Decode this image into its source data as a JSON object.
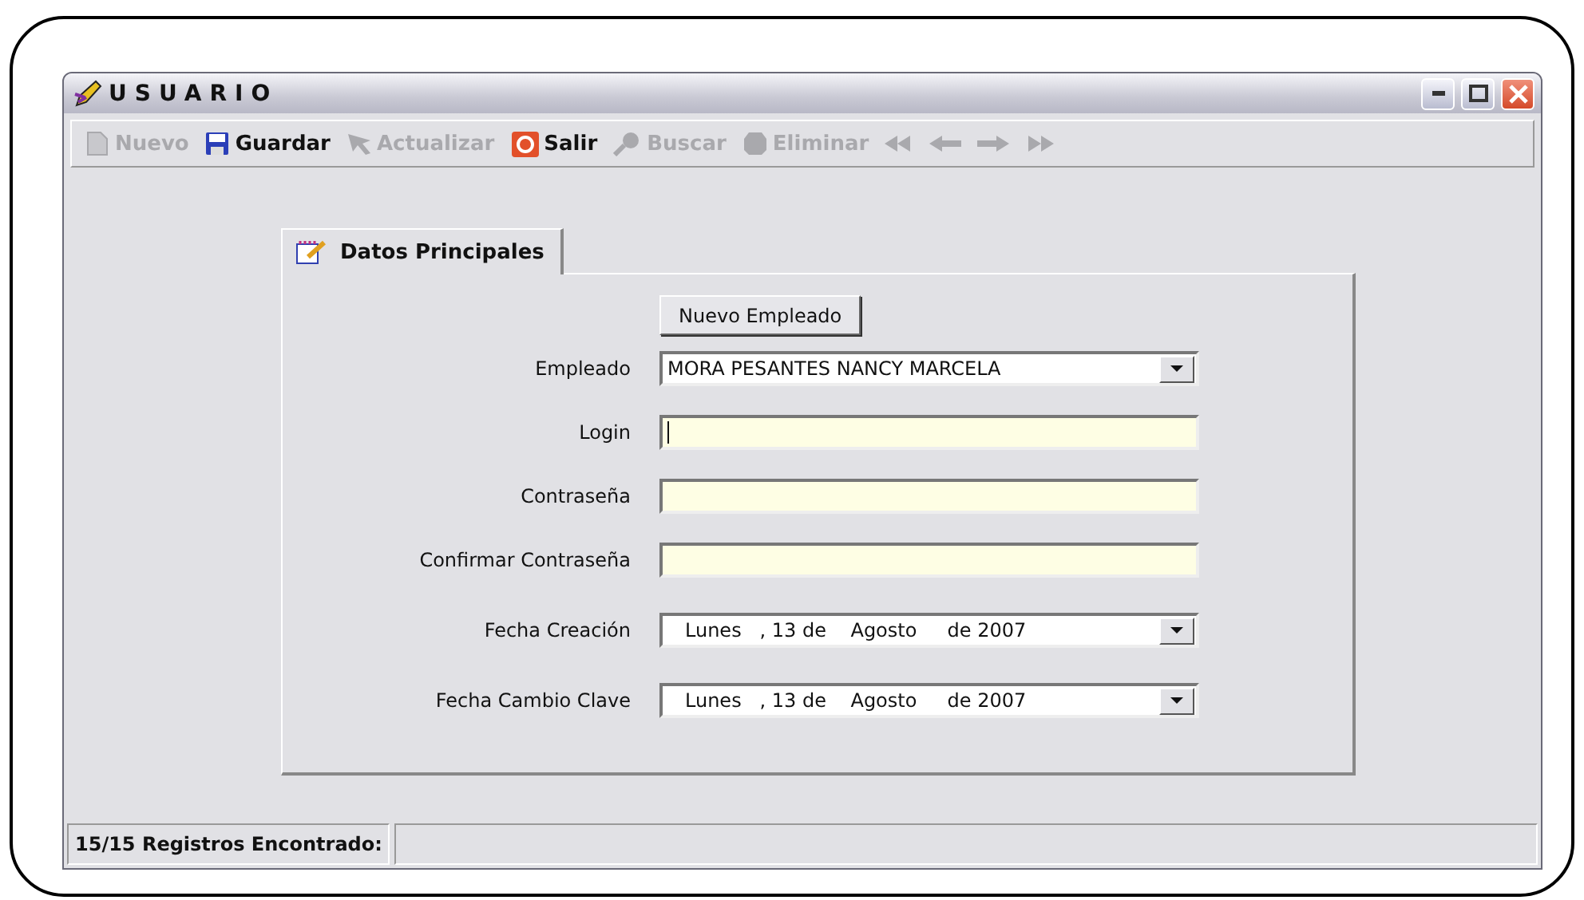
{
  "window": {
    "title": "USUARIO"
  },
  "toolbar": [
    {
      "label": "Nuevo",
      "kind": "page",
      "enabled": false
    },
    {
      "label": "Guardar",
      "kind": "disk",
      "enabled": true
    },
    {
      "label": "Actualizar",
      "kind": "arrow",
      "enabled": false
    },
    {
      "label": "Salir",
      "kind": "exit",
      "enabled": true
    },
    {
      "label": "Buscar",
      "kind": "search",
      "enabled": false
    },
    {
      "label": "Eliminar",
      "kind": "blob",
      "enabled": false
    }
  ],
  "navigation": [
    {
      "kind": "first",
      "enabled": false
    },
    {
      "kind": "prev",
      "enabled": false
    },
    {
      "kind": "next",
      "enabled": false
    },
    {
      "kind": "last",
      "enabled": false
    }
  ],
  "tabs": [
    {
      "label": "Datos Principales",
      "selected": true
    }
  ],
  "new_button": "Nuevo Empleado",
  "fields": [
    {
      "kind": "combo",
      "label": "Empleado",
      "value": "MORA PESANTES NANCY MARCELA"
    },
    {
      "kind": "text",
      "label": "Login",
      "focused": true
    },
    {
      "kind": "text",
      "label": "Contraseña",
      "focused": false
    },
    {
      "kind": "text",
      "label": "Confirmar Contraseña",
      "focused": false
    },
    {
      "kind": "date",
      "label": "Fecha Creación",
      "value": "Lunes   , 13 de    Agosto     de 2007"
    },
    {
      "kind": "date",
      "label": "Fecha Cambio Clave",
      "value": "Lunes   , 13 de    Agosto     de 2007"
    }
  ],
  "status_bar": {
    "text": "15/15 Registros Encontrado:"
  }
}
